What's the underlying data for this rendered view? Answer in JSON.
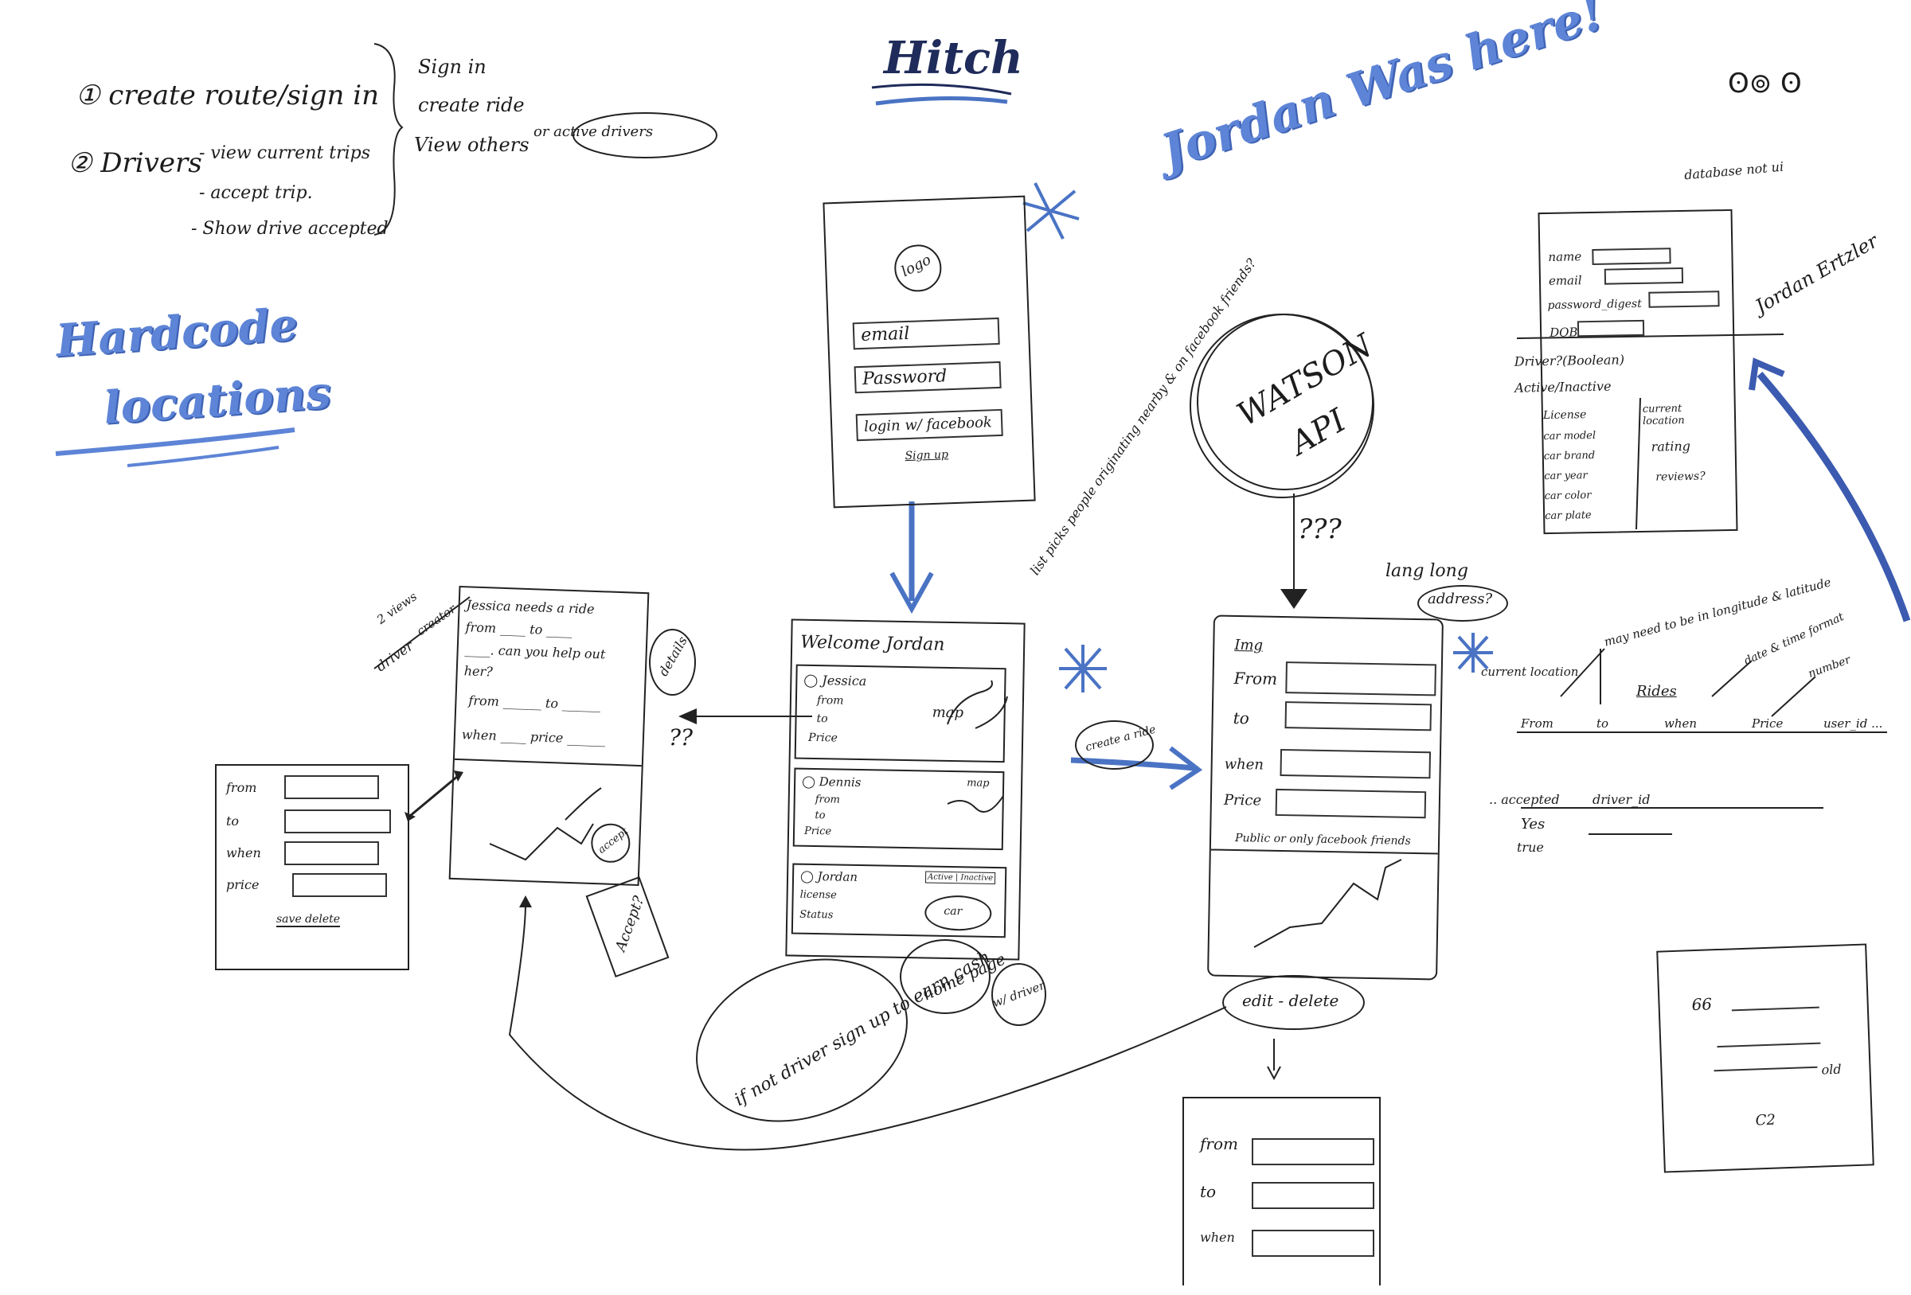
{
  "title": "Hitch",
  "signature_top_right": "Jordan Was here!",
  "corner_mark": "ʘ⊚ ʘ",
  "todo": {
    "item1": "create route/sign in",
    "item2": "Drivers",
    "sub": [
      "- view current trips",
      "- accept trip.",
      "- Show drive accepted"
    ],
    "right": [
      "Sign in",
      "create ride",
      "View others"
    ],
    "bubble": "or active drivers"
  },
  "hardcode": [
    "Hardcode",
    "locations"
  ],
  "login": {
    "logo": "logo",
    "email": "email",
    "password": "Password",
    "facebook": "login w/ facebook",
    "signup": "Sign up"
  },
  "watson": {
    "line1": "WATSON",
    "line2": "API",
    "q": "???"
  },
  "home": {
    "welcome": "Welcome Jordan",
    "note": "list picks people originating nearby & on facebook friends?",
    "card1": {
      "name": "Jessica",
      "lines": [
        "from",
        "to",
        "Price"
      ],
      "map": "map"
    },
    "card2": {
      "name": "Dennis",
      "lines": [
        "from",
        "to",
        "Price"
      ],
      "map": "map"
    },
    "card3": {
      "name": "Jordan",
      "lines": [
        "license",
        "Status"
      ],
      "toggle": "Active | Inactive",
      "car": "car"
    },
    "bubbles": [
      "home page",
      "w/ driver"
    ],
    "driver_note": "if not driver sign up to earn cash"
  },
  "ride_request": {
    "text1": "Jessica needs a ride",
    "text2": "from ____ to ____",
    "text3": "____. can you help out",
    "text4": "her?",
    "text5": "from ______ to ______",
    "text6": "when ____ price ______",
    "details": "details",
    "q": "??",
    "accept": "accept",
    "accept_note": "Accept?",
    "views_note": "2 views",
    "driver": "driver",
    "creator": "creator"
  },
  "small_form": {
    "labels": [
      "from",
      "to",
      "when",
      "price"
    ],
    "bottom": "save delete"
  },
  "create_ride": {
    "bubble": "create a ride",
    "title": "Img",
    "labels": [
      "From",
      "to",
      "when",
      "Price"
    ],
    "footer": "Public or only facebook friends",
    "latlong": "lang long",
    "address": "address?",
    "current": "current location",
    "edit": "edit - delete"
  },
  "bottom_form": {
    "labels": [
      "from",
      "to",
      "when"
    ]
  },
  "db": {
    "header_note": "database not ui",
    "fields": [
      "name",
      "email",
      "password_digest",
      "DOB"
    ],
    "driver": "Driver?(Boolean)",
    "active": "Active/Inactive",
    "left": [
      "License",
      "car model",
      "car brand",
      "car year",
      "car color",
      "car plate"
    ],
    "right": [
      "current location",
      "rating",
      "reviews?"
    ],
    "signature": "Jordan Ertzler"
  },
  "rides": {
    "note": "may need to be in longitude & latitude",
    "title": "Rides",
    "date_note": "date & time format",
    "number": "number",
    "cols": [
      "From",
      "to",
      "when",
      "Price",
      "user_id ..."
    ],
    "accepted": "accepted",
    "driver_id": "driver_id",
    "yes": "Yes",
    "true": "true"
  },
  "corner_form": {
    "a": "66",
    "b": "old",
    "c": "C2"
  }
}
